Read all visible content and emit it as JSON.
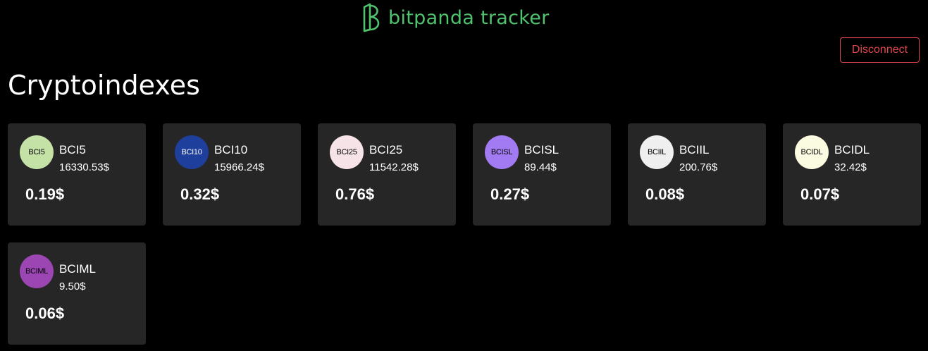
{
  "app": {
    "brand_name": "bitpanda tracker",
    "brand_color": "#4fc36d"
  },
  "header": {
    "disconnect_label": "Disconnect",
    "disconnect_color": "#e0474c"
  },
  "page": {
    "title": "Cryptoindexes"
  },
  "indexes": [
    {
      "badge": "BCI5",
      "name": "BCI5",
      "price": "16330.53$",
      "holding": "0.19$",
      "badge_bg": "#c5e2a6",
      "badge_fg": "#000000"
    },
    {
      "badge": "BCI10",
      "name": "BCI10",
      "price": "15966.24$",
      "holding": "0.32$",
      "badge_bg": "#1f3f9c",
      "badge_fg": "#ffffff"
    },
    {
      "badge": "BCI25",
      "name": "BCI25",
      "price": "11542.28$",
      "holding": "0.76$",
      "badge_bg": "#f6e3e8",
      "badge_fg": "#000000"
    },
    {
      "badge": "BCISL",
      "name": "BCISL",
      "price": "89.44$",
      "holding": "0.27$",
      "badge_bg": "#a27af2",
      "badge_fg": "#000000"
    },
    {
      "badge": "BCIIL",
      "name": "BCIIL",
      "price": "200.76$",
      "holding": "0.08$",
      "badge_bg": "#efefef",
      "badge_fg": "#000000"
    },
    {
      "badge": "BCIDL",
      "name": "BCIDL",
      "price": "32.42$",
      "holding": "0.07$",
      "badge_bg": "#fbfbe2",
      "badge_fg": "#000000"
    },
    {
      "badge": "BCIML",
      "name": "BCIML",
      "price": "9.50$",
      "holding": "0.06$",
      "badge_bg": "#9b46b3",
      "badge_fg": "#000000"
    }
  ]
}
